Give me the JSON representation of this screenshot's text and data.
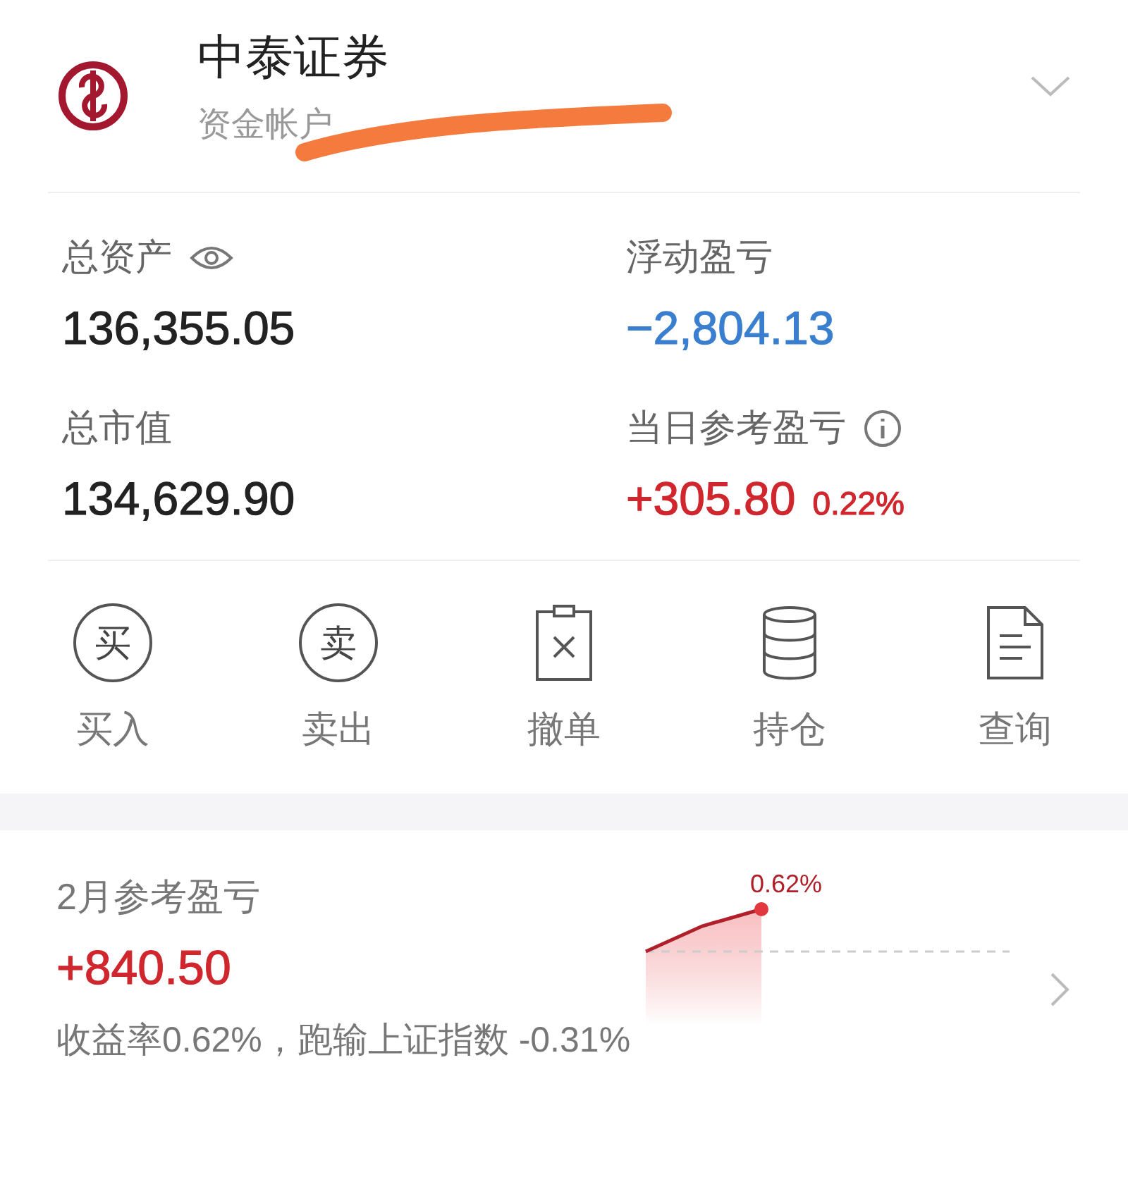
{
  "account": {
    "broker": "中泰证券",
    "label": "资金帐户",
    "redacted": true
  },
  "stats": [
    {
      "label": "总资产",
      "eye": true,
      "value": "136,355.05",
      "color": "#222222"
    },
    {
      "label": "浮动盈亏",
      "value": "−2,804.13",
      "color": "#3a7fcf"
    },
    {
      "label": "总市值",
      "value": "134,629.90",
      "color": "#222222"
    },
    {
      "label": "当日参考盈亏",
      "info": true,
      "value": "+305.80",
      "color": "#d0262d",
      "percent": "0.22%"
    }
  ],
  "actions": [
    {
      "kind": "char",
      "glyph": "买",
      "label": "买入"
    },
    {
      "kind": "char",
      "glyph": "卖",
      "label": "卖出"
    },
    {
      "kind": "cancel",
      "label": "撤单"
    },
    {
      "kind": "stack",
      "label": "持仓"
    },
    {
      "kind": "doc",
      "label": "查询"
    }
  ],
  "monthly": {
    "title": "2月参考盈亏",
    "value": "+840.50",
    "chart_label": "0.62%",
    "summary": "收益率0.62%，跑输上证指数 -0.31%"
  }
}
